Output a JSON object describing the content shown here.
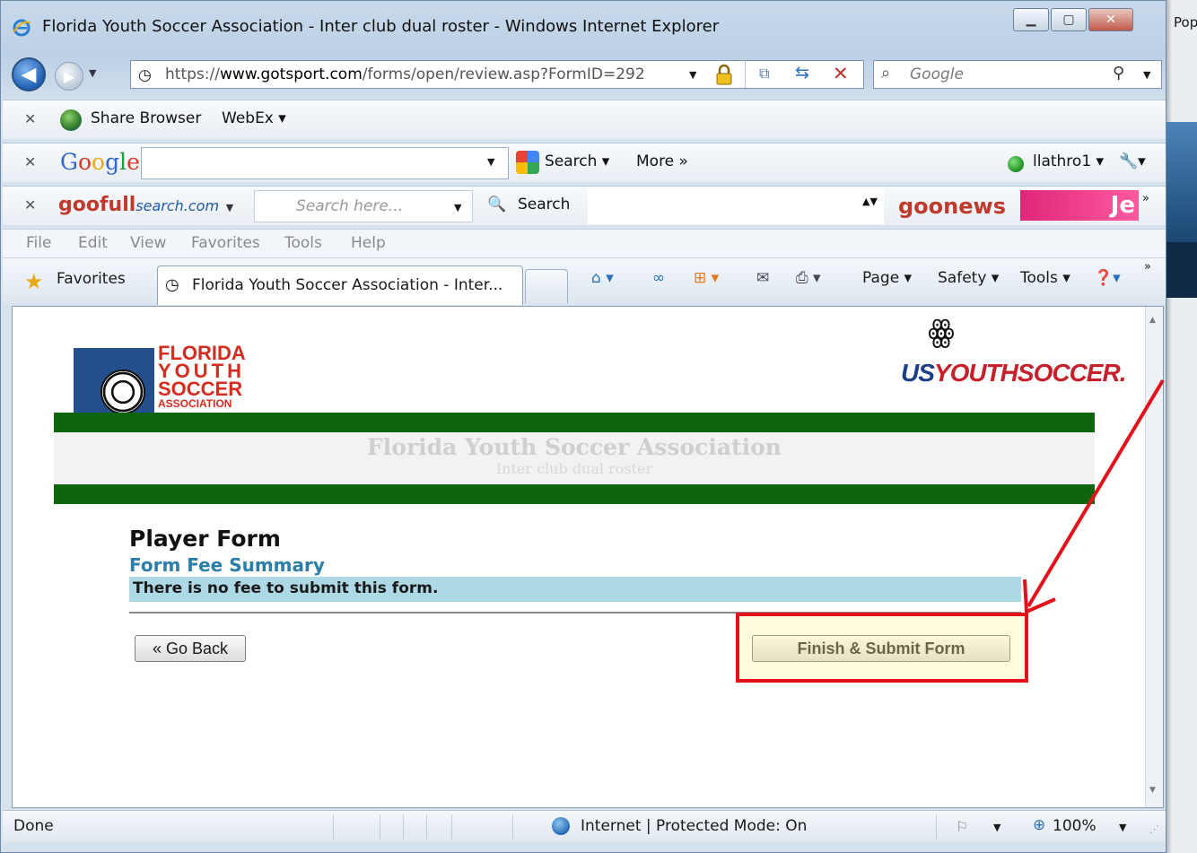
{
  "window": {
    "title": "Florida Youth Soccer Association - Inter club dual roster - Windows Internet Explorer"
  },
  "background": {
    "peek_text": "Pop"
  },
  "address_bar": {
    "url_scheme": "https://",
    "url_domain": "www.gotsport.com",
    "url_path": "/forms/open/review.asp?FormID=292"
  },
  "search": {
    "placeholder": "Google"
  },
  "toolbar_share": {
    "share_label": "Share Browser",
    "webex_label": "WebEx ▾"
  },
  "toolbar_google": {
    "search_label": "Search ▾",
    "more_label": "More »",
    "user_label": "llathro1 ▾"
  },
  "toolbar_goofull": {
    "logo_main": "goofull",
    "logo_sub": "search.com",
    "placeholder": "Search here...",
    "search_label": "Search",
    "news_logo": "goonews",
    "banner_text": "Je"
  },
  "menu": {
    "items": [
      "File",
      "Edit",
      "View",
      "Favorites",
      "Tools",
      "Help"
    ]
  },
  "favorites_bar": {
    "favorites_label": "Favorites",
    "tab_title": "Florida Youth Soccer Association - Inter...",
    "commands": {
      "page": "Page ▾",
      "safety": "Safety ▾",
      "tools": "Tools ▾"
    }
  },
  "page": {
    "fysa_logo_lines": [
      "FLORIDA",
      "YOUTH",
      "SOCCER",
      "ASSOCIATION"
    ],
    "usys_logo": {
      "us": "US",
      "rest": "YOUTHSOCCER."
    },
    "banner_title": "Florida Youth Soccer Association",
    "banner_subtitle": "Inter club dual roster",
    "form_heading": "Player Form",
    "fee_section_title": "Form Fee Summary",
    "fee_message": "There is no fee to submit this form.",
    "go_back_label": "« Go Back",
    "submit_label": "Finish & Submit Form"
  },
  "status_bar": {
    "status": "Done",
    "zone": "Internet | Protected Mode: On",
    "zoom": "100%"
  },
  "icons": {
    "ie": "ie-logo-icon",
    "back": "back-arrow-icon",
    "forward": "forward-arrow-icon",
    "lock": "lock-icon",
    "refresh": "refresh-icon",
    "stop": "stop-icon",
    "search": "search-icon",
    "home": "home-icon",
    "feeds": "rss-icon",
    "print": "print-icon",
    "help": "help-icon",
    "globe": "globe-icon"
  },
  "colors": {
    "header_green": "#0e650e",
    "fee_bar": "#add8e6",
    "fee_title": "#2a7ea8",
    "annotation_red": "#e5111a"
  }
}
